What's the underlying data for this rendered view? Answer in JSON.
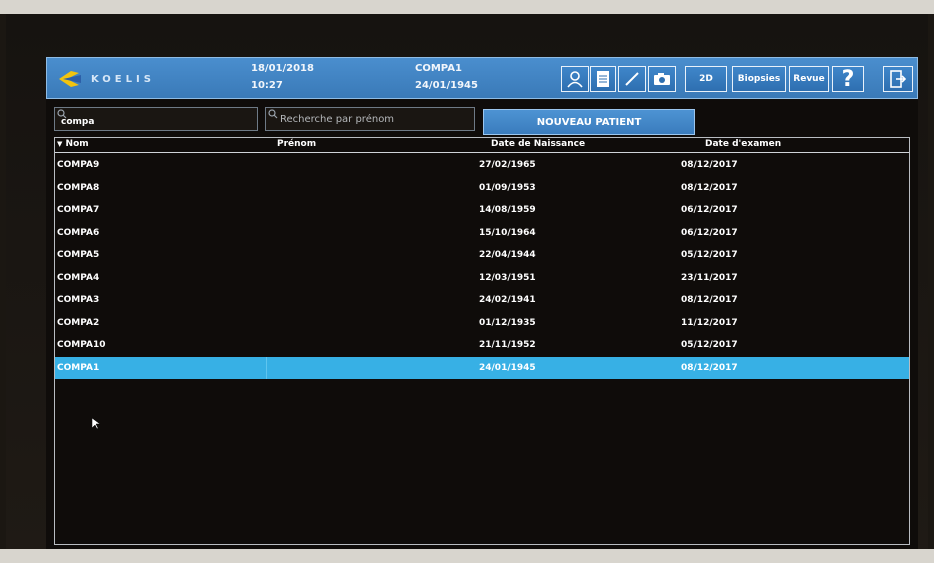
{
  "header": {
    "logo_text": "KOELIS",
    "date": "18/01/2018",
    "time": "10:27",
    "patient_name": "COMPA1",
    "patient_birth": "24/01/1945",
    "buttons": {
      "mode_2d": "2D",
      "biopsies": "Biopsies",
      "revue": "Revue",
      "help": "?"
    }
  },
  "search": {
    "name_value": "compa",
    "firstname_placeholder": "Recherche par prénom"
  },
  "new_patient_label": "NOUVEAU PATIENT",
  "table": {
    "columns": [
      "Nom",
      "Prénom",
      "Date de Naissance",
      "Date d'examen"
    ],
    "rows": [
      {
        "nom": "COMPA9",
        "prenom": "",
        "naissance": "27/02/1965",
        "examen": "08/12/2017"
      },
      {
        "nom": "COMPA8",
        "prenom": "",
        "naissance": "01/09/1953",
        "examen": "08/12/2017"
      },
      {
        "nom": "COMPA7",
        "prenom": "",
        "naissance": "14/08/1959",
        "examen": "06/12/2017"
      },
      {
        "nom": "COMPA6",
        "prenom": "",
        "naissance": "15/10/1964",
        "examen": "06/12/2017"
      },
      {
        "nom": "COMPA5",
        "prenom": "",
        "naissance": "22/04/1944",
        "examen": "05/12/2017"
      },
      {
        "nom": "COMPA4",
        "prenom": "",
        "naissance": "12/03/1951",
        "examen": "23/11/2017"
      },
      {
        "nom": "COMPA3",
        "prenom": "",
        "naissance": "24/02/1941",
        "examen": "08/12/2017"
      },
      {
        "nom": "COMPA2",
        "prenom": "",
        "naissance": "01/12/1935",
        "examen": "11/12/2017"
      },
      {
        "nom": "COMPA10",
        "prenom": "",
        "naissance": "21/11/1952",
        "examen": "05/12/2017"
      },
      {
        "nom": "COMPA1",
        "prenom": "",
        "naissance": "24/01/1945",
        "examen": "08/12/2017"
      }
    ],
    "selected_index": 9
  },
  "colors": {
    "accent": "#3f86ca",
    "selected_row": "#37b0e5"
  }
}
